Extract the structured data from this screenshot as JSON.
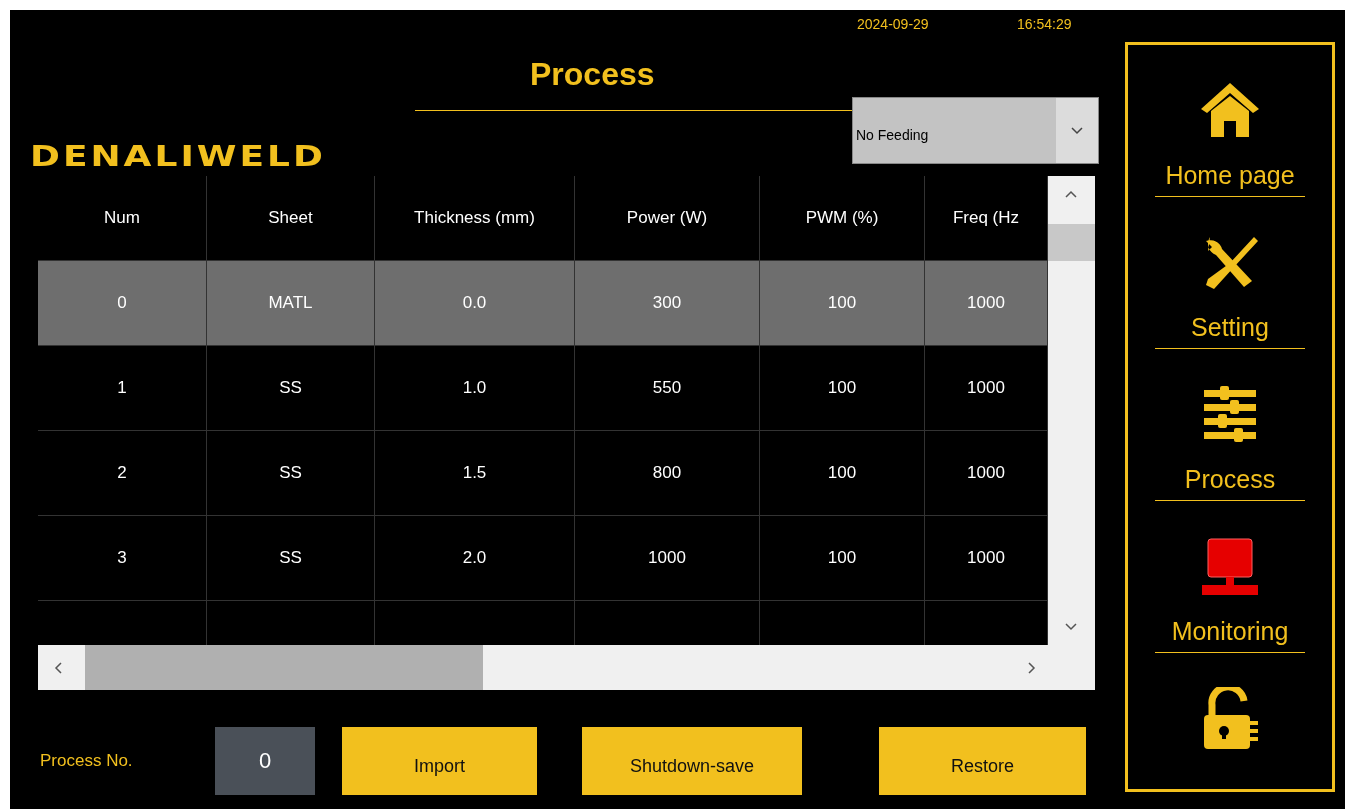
{
  "header": {
    "logo": "DENALIWELD",
    "title": "Process",
    "date": "2024-09-29",
    "time": "16:54:29",
    "feed_select": {
      "value": "No Feeding"
    }
  },
  "table": {
    "columns": [
      "Num",
      "Sheet",
      "Thickness (mm)",
      "Power (W)",
      "PWM (%)",
      "Freq (Hz"
    ],
    "rows": [
      {
        "cells": [
          "0",
          "MATL",
          "0.0",
          "300",
          "100",
          "1000"
        ],
        "selected": true
      },
      {
        "cells": [
          "1",
          "SS",
          "1.0",
          "550",
          "100",
          "1000"
        ],
        "selected": false
      },
      {
        "cells": [
          "2",
          "SS",
          "1.5",
          "800",
          "100",
          "1000"
        ],
        "selected": false
      },
      {
        "cells": [
          "3",
          "SS",
          "2.0",
          "1000",
          "100",
          "1000"
        ],
        "selected": false
      }
    ]
  },
  "footer": {
    "process_no_label": "Process No.",
    "process_no": "0",
    "buttons": [
      "Import",
      "Shutdown-save",
      "Restore"
    ]
  },
  "sidebar": {
    "items": [
      {
        "kind": "home",
        "label": "Home page"
      },
      {
        "kind": "tools",
        "label": "Setting"
      },
      {
        "kind": "sliders",
        "label": "Process"
      },
      {
        "kind": "monitor",
        "label": "Monitoring"
      }
    ],
    "lock": {
      "kind": "lock"
    }
  }
}
